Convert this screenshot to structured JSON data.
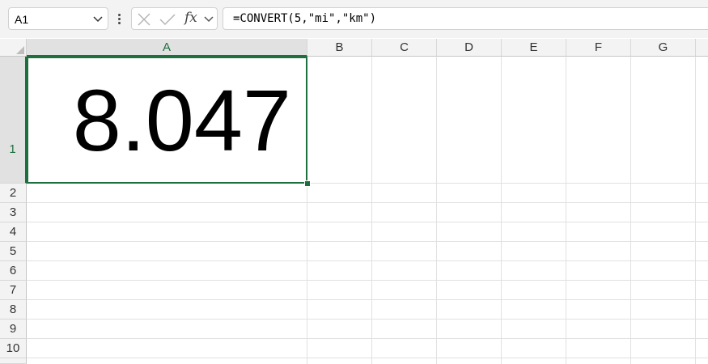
{
  "formula_bar": {
    "name_box": "A1",
    "formula": "=CONVERT(5,\"mi\",\"km\")",
    "fx_label": "fx"
  },
  "columns": [
    "A",
    "B",
    "C",
    "D",
    "E",
    "F",
    "G"
  ],
  "rows": [
    "1",
    "2",
    "3",
    "4",
    "5",
    "6",
    "7",
    "8",
    "9",
    "10"
  ],
  "selected_cell": {
    "column": "A",
    "row": "1",
    "value": "8.047"
  },
  "colors": {
    "accent": "#1e6f3e",
    "header_bg": "#f3f3f3",
    "gridline": "#e1e1e1"
  }
}
